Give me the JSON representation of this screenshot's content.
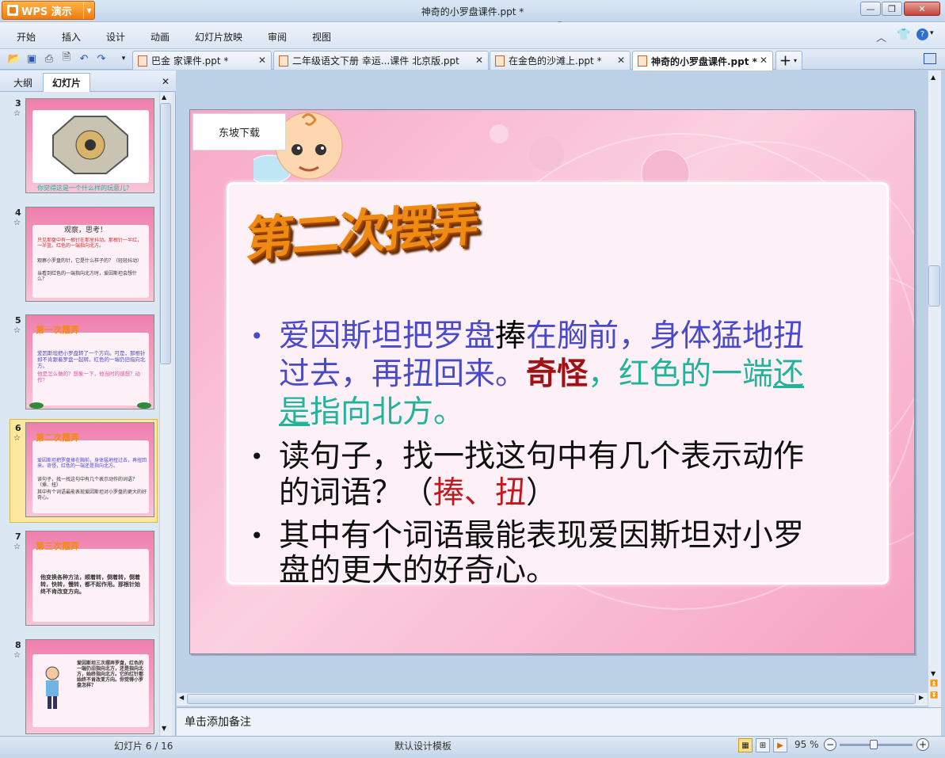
{
  "app": {
    "button_label": "WPS 演示",
    "window_title": "神奇的小罗盘课件.ppt *"
  },
  "menu": [
    "开始",
    "插入",
    "设计",
    "动画",
    "幻灯片放映",
    "审阅",
    "视图"
  ],
  "tabs": [
    {
      "label": "巴金  家课件.ppt *",
      "active": false
    },
    {
      "label": "二年级语文下册 幸运...课件 北京版.ppt",
      "active": false
    },
    {
      "label": "在金色的沙滩上.ppt *",
      "active": false
    },
    {
      "label": "神奇的小罗盘课件.ppt *",
      "active": true
    }
  ],
  "left_panel": {
    "tabs": [
      "大纲",
      "幻灯片"
    ],
    "thumbnails": [
      {
        "num": "3",
        "caption": "你觉得这是一个什么样的玩意儿？"
      },
      {
        "num": "4",
        "title": "观察，思考！",
        "lines": [
          "只见那盘中有一根针在那里抖动。那根针一半红，一半蓝。红色的一端指向北方。",
          "观察小罗盘的针，它是什么样子的？（轻轻抖动）",
          "当看到红色的一端指向北方时，爱因斯坦会想什么？"
        ]
      },
      {
        "num": "5",
        "title": "第一次摆弄",
        "lines": [
          "爱因斯坦把小罗盘转了一个方向。可是，那根针却不肯跟着罗盘一起转。红色的一端仍旧指向北方。",
          "他是怎么做的？想象一下，他当时的感想？动作？"
        ]
      },
      {
        "num": "6",
        "title": "第二次摆弄",
        "lines": [
          "爱因斯坦把罗盘捧在胸前，身体猛地扭过去，再扭回来。奇怪，红色的一端还是指向北方。",
          "读句子，找一找这句中有几个表示动作的词语？（捧、扭）",
          "其中有个词语最能表现爱因斯坦对小罗盘的更大的好奇心。"
        ]
      },
      {
        "num": "7",
        "title": "第三次摆弄",
        "lines": [
          "他变换各种方法，顺着转，倒着转，倒着转，快转，慢转，都不起作用。那根针始终不肯改变方向。"
        ]
      },
      {
        "num": "8",
        "lines": [
          "爱因斯坦三次摆弄罗盘，红色的一端仍旧指向北方，还是指向北方，始终指向北方。它的红针都始终不肯改变方向。你觉得小罗盘怎样？"
        ]
      }
    ]
  },
  "slide": {
    "watermark": "东坡下载",
    "title": "第二次摆弄",
    "bullet1_a": "爱因斯坦把罗盘",
    "bullet1_b": "捧",
    "bullet1_c": "在胸前，身体猛地扭",
    "bullet1_d": "过去，再扭回来。",
    "bullet1_e": "奇怪",
    "bullet1_f": "，红色的一端",
    "bullet1_g": "还",
    "bullet1_h": "是",
    "bullet1_i": "指向北方。",
    "bullet2_a": "读句子，找一找这句中有几个表示动作",
    "bullet2_b": "的词语？（",
    "bullet2_c": "捧、扭",
    "bullet2_d": "）",
    "bullet3_a": "其中有个词语最能表现爱因斯坦对小罗",
    "bullet3_b": "盘的更大的好奇心。",
    "colors": {
      "blue": "#4a4ac8",
      "green": "#22b39a",
      "red": "#c0181c",
      "title": "#f08a12"
    }
  },
  "notes_placeholder": "单击添加备注",
  "status": {
    "slide_counter": "幻灯片 6 / 16",
    "template": "默认设计模板",
    "zoom": "95 %"
  }
}
